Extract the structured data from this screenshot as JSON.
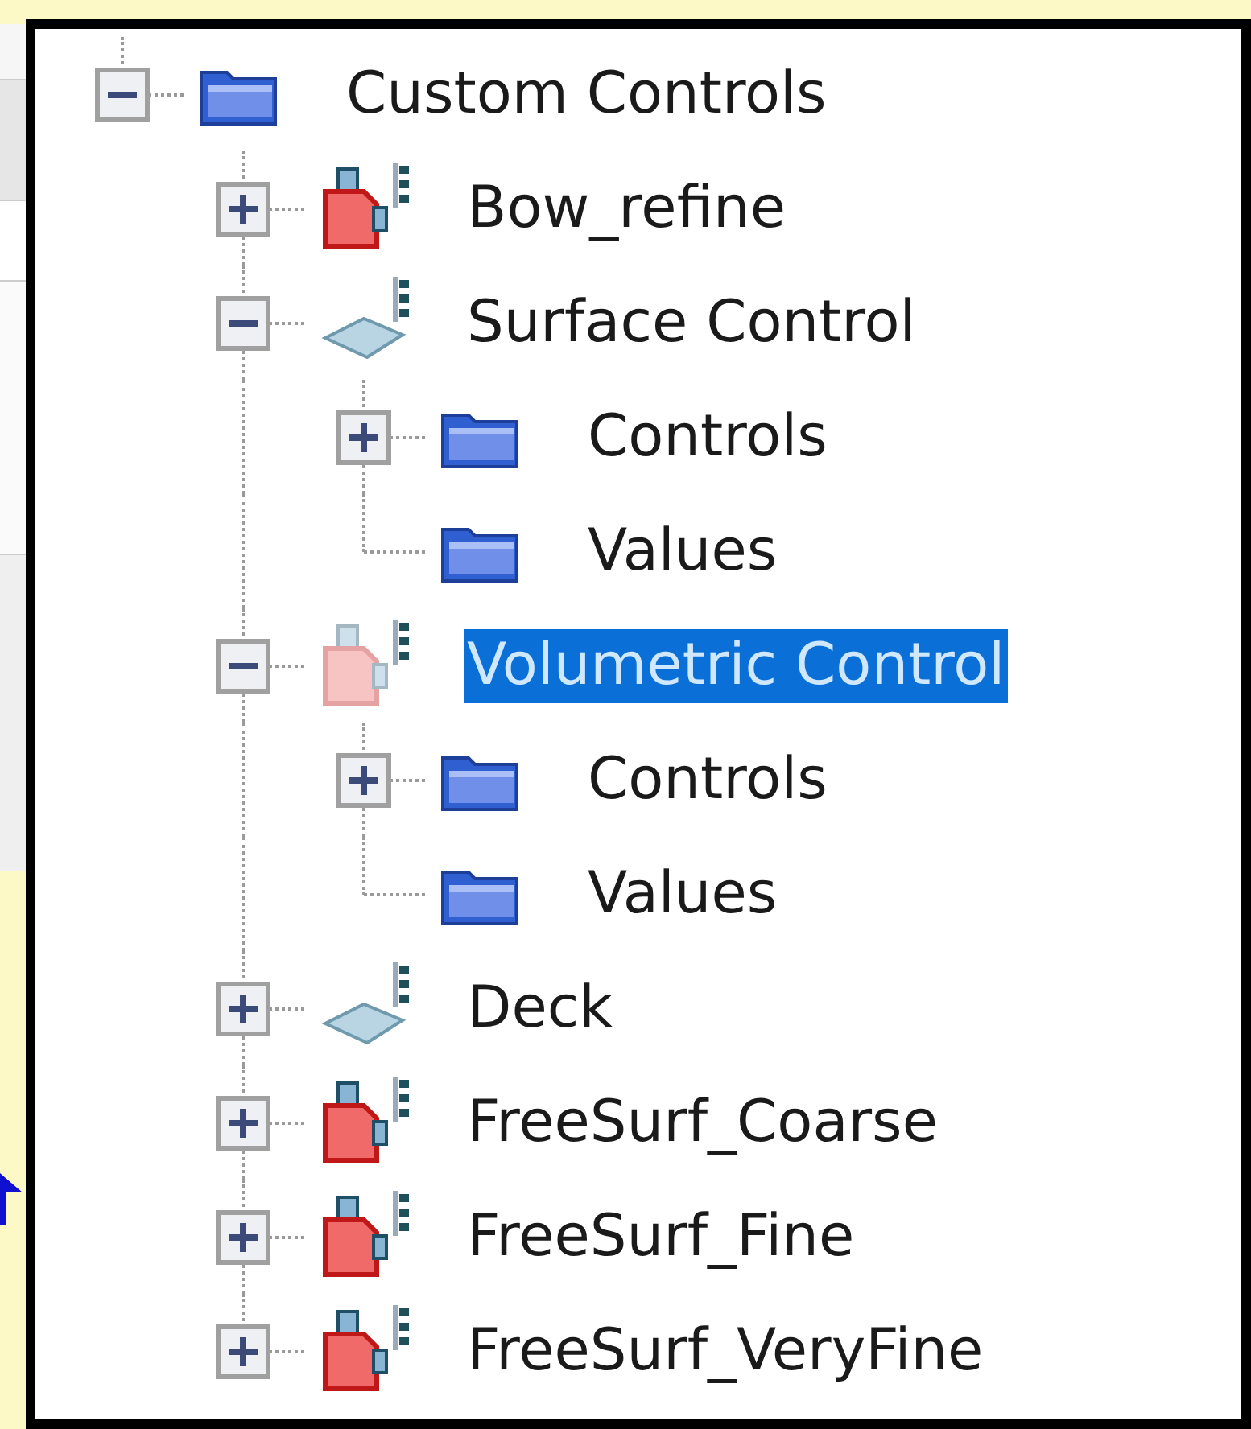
{
  "tree": [
    {
      "label": "Custom Controls",
      "kind": "folder",
      "expanded": true,
      "selected": false,
      "faded": false,
      "children": [
        {
          "label": "Bow_refine",
          "kind": "block",
          "expanded": false,
          "selected": false,
          "faded": false
        },
        {
          "label": "Surface Control",
          "kind": "surface",
          "expanded": true,
          "selected": false,
          "faded": false,
          "children": [
            {
              "label": "Controls",
              "kind": "folder",
              "expanded": false,
              "selected": false,
              "faded": false
            },
            {
              "label": "Values",
              "kind": "folder",
              "selected": false,
              "faded": false
            }
          ]
        },
        {
          "label": "Volumetric Control",
          "kind": "block",
          "expanded": true,
          "selected": true,
          "faded": true,
          "children": [
            {
              "label": "Controls",
              "kind": "folder",
              "expanded": false,
              "selected": false,
              "faded": false
            },
            {
              "label": "Values",
              "kind": "folder",
              "selected": false,
              "faded": false
            }
          ]
        },
        {
          "label": "Deck",
          "kind": "surface",
          "expanded": false,
          "selected": false,
          "faded": false
        },
        {
          "label": "FreeSurf_Coarse",
          "kind": "block",
          "expanded": false,
          "selected": false,
          "faded": false
        },
        {
          "label": "FreeSurf_Fine",
          "kind": "block",
          "expanded": false,
          "selected": false,
          "faded": false
        },
        {
          "label": "FreeSurf_VeryFine",
          "kind": "block",
          "expanded": false,
          "selected": false,
          "faded": false
        }
      ]
    }
  ]
}
